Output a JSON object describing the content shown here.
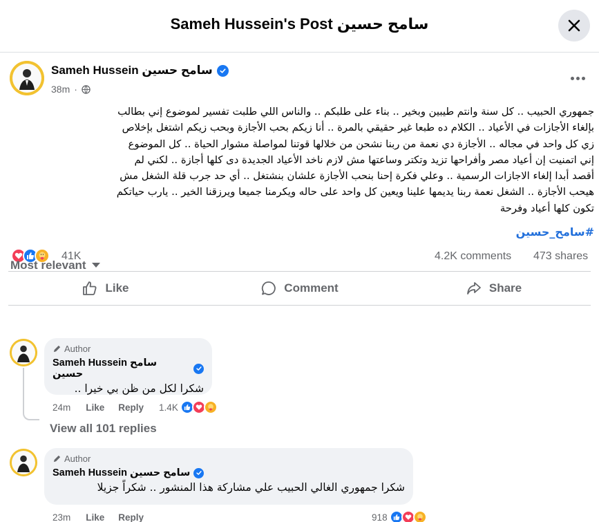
{
  "header": {
    "title": "Sameh Hussein's Post سامح حسين",
    "close_icon": "close-icon"
  },
  "post": {
    "author": "Sameh Hussein سامح حسين",
    "time": "38m",
    "audience_icon": "globe-icon",
    "text_lines": [
      "جمهوري الحبيب .. كل سنة وانتم طيبين وبخير .. بناء على طلبكم .. والناس اللي طلبت تفسير لموضوع إني بطالب",
      "بإلغاء الأجازات في الأعياد .. الكلام ده طبعا غير حقيقي بالمرة .. أنا زيكم بحب الأجازة وبحب زيكم اشتغل بإخلاص",
      "زي كل واحد في مجاله .. الأجازة دي نعمة من ربنا نشحن من خلالها قوتنا لمواصلة مشوار الحياة .. كل الموضوع",
      "إني اتمنيت إن أعياد مصر وأفراحها تزيد وتكتر وساعتها مش لازم ناخد الأعياد الجديدة دى كلها أجازة .. لكني لم",
      "أقصد أبدا إلغاء الاجازات الرسمية .. وعلي فكرة إحنا بنحب الأجازة علشان بنشتغل .. أي حد جرب قلة الشغل مش",
      "هيحب الأجازة .. الشغل نعمة ربنا يديمها علينا ويعين كل واحد على حاله ويكرمنا جميعا ويرزقنا الخير .. يارب حياتكم",
      "تكون كلها أعياد وفرحة"
    ],
    "hashtag": "#سامح_حسين",
    "reaction_count": "41K",
    "comments_count": "4.2K comments",
    "shares_count": "473 shares"
  },
  "actions": {
    "like": "Like",
    "comment": "Comment",
    "share": "Share"
  },
  "sort": {
    "label": "Most relevant"
  },
  "comments": [
    {
      "badge": "Author",
      "author": "Sameh Hussein سامح حسين",
      "text": "شكرا لكل من ظن بي خيرا ..",
      "time": "24m",
      "like": "Like",
      "reply": "Reply",
      "reaction_count": "1.4K"
    },
    {
      "badge": "Author",
      "author": "Sameh Hussein سامح حسين",
      "text": "شكرا جمهوري الغالي الحبيب علي مشاركة هذا المنشور .. شكراً جزيلا",
      "time": "23m",
      "like": "Like",
      "reply": "Reply",
      "reaction_count": "918"
    }
  ],
  "view_replies": "View all 101 replies",
  "colors": {
    "verified": "#1877f2",
    "hashtag": "#216fdb",
    "love": "#f33e58",
    "care": "#f7b125",
    "muted": "#65676b"
  }
}
